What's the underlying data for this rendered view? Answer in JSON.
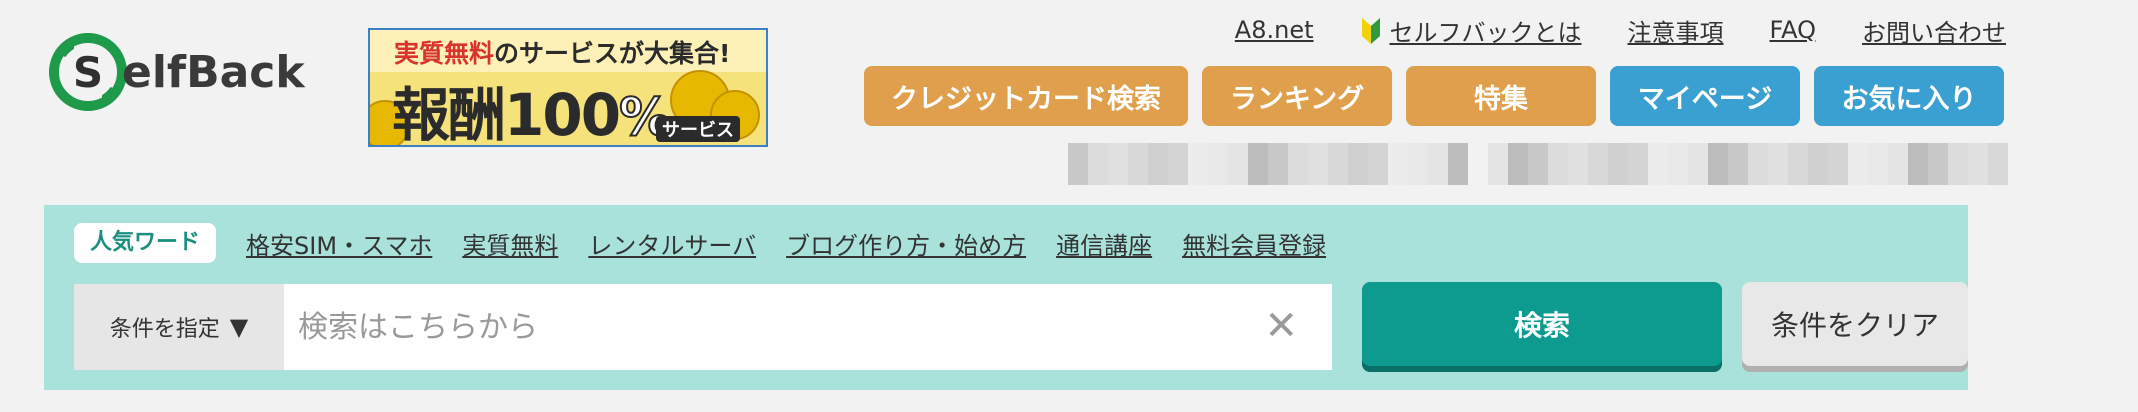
{
  "logo": {
    "text": "elfBack",
    "mark_letter": "S"
  },
  "banner": {
    "line1_red": "実質無料",
    "line1_black": "のサービスが大集合!",
    "line2": "報酬100",
    "line2_pct": "%",
    "sub": "サービス"
  },
  "top_links": [
    {
      "label": "A8.net"
    },
    {
      "label": "セルフバックとは",
      "icon": "wakaba-leaf-icon"
    },
    {
      "label": "注意事項"
    },
    {
      "label": "FAQ"
    },
    {
      "label": "お問い合わせ"
    }
  ],
  "nav_buttons": [
    {
      "label": "クレジットカード検索",
      "color": "#e09f4c"
    },
    {
      "label": "ランキング",
      "color": "#e09f4c"
    },
    {
      "label": "特集",
      "color": "#e09f4c"
    },
    {
      "label": "マイページ",
      "color": "#3a9fd1"
    },
    {
      "label": "お気に入り",
      "color": "#3a9fd1"
    }
  ],
  "popular": {
    "badge": "人気ワード",
    "words": [
      "格安SIM・スマホ",
      "実質無料",
      "レンタルサーバ",
      "ブログ作り方・始め方",
      "通信講座",
      "無料会員登録"
    ]
  },
  "search": {
    "condition_label": "条件を指定",
    "condition_icon": "triangle-down-icon",
    "placeholder": "検索はこちらから",
    "value": "",
    "clear_icon": "close-icon",
    "search_button": "検索",
    "clear_button": "条件をクリア"
  },
  "colors": {
    "background": "#f2f2f2",
    "panel": "#a9e2db",
    "orange": "#e09f4c",
    "blue": "#3a9fd1",
    "teal": "#0d9b8f",
    "logo_green": "#1f9a4a"
  }
}
